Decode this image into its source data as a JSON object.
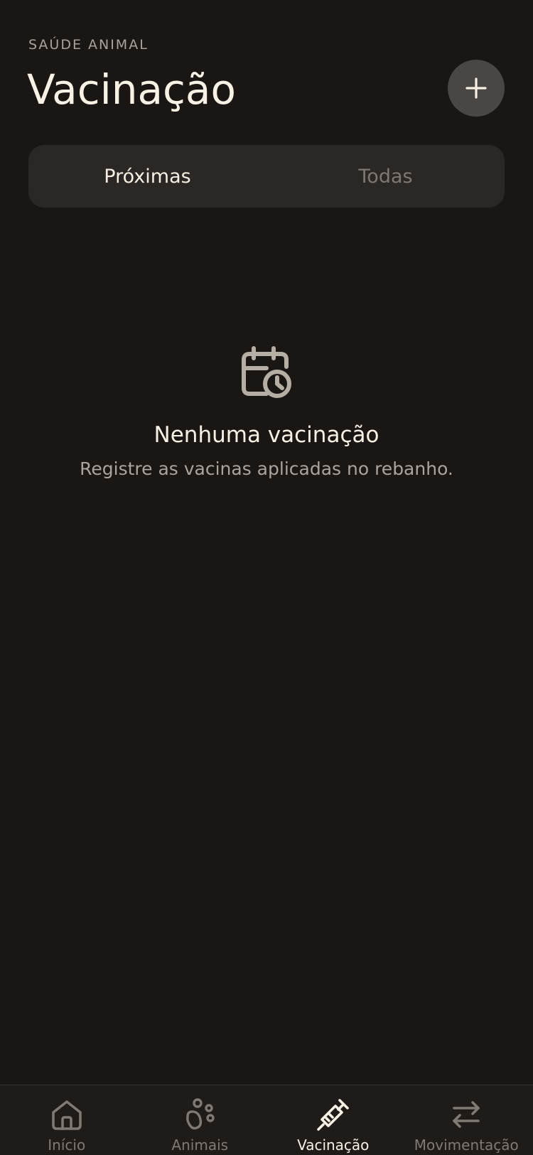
{
  "header": {
    "eyebrow": "SAÚDE ANIMAL",
    "title": "Vacinação"
  },
  "add_button": {
    "icon": "plus-icon"
  },
  "segments": [
    {
      "label": "Próximas",
      "active": true
    },
    {
      "label": "Todas",
      "active": false
    }
  ],
  "empty_state": {
    "icon": "calendar-clock-icon",
    "title": "Nenhuma vacinação",
    "subtitle": "Registre as vacinas aplicadas no rebanho."
  },
  "tabbar": {
    "items": [
      {
        "label": "Início",
        "icon": "home-icon",
        "active": false
      },
      {
        "label": "Animais",
        "icon": "paw-icon",
        "active": false
      },
      {
        "label": "Vacinação",
        "icon": "syringe-icon",
        "active": true
      },
      {
        "label": "Movimentação",
        "icon": "transfer-arrows-icon",
        "active": false
      }
    ]
  },
  "colors": {
    "background": "#1a1614",
    "surface": "#2a2725",
    "accent_text": "#f7f0e5",
    "muted_text": "#807a74",
    "icon_muted": "#b5aea5"
  }
}
